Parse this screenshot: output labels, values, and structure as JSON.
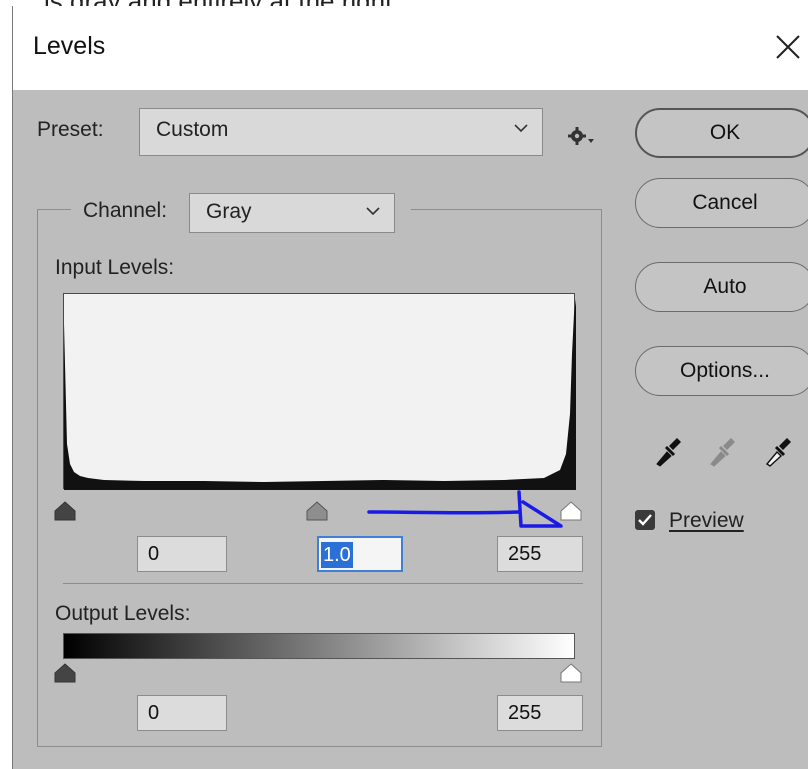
{
  "crop_text": "is gray and entirely at the right",
  "dialog": {
    "title": "Levels",
    "close_label": "close"
  },
  "preset": {
    "label": "Preset:",
    "value": "Custom"
  },
  "channel": {
    "label": "Channel:",
    "value": "Gray"
  },
  "input_levels": {
    "label": "Input Levels:",
    "black": "0",
    "gamma": "1.0",
    "white": "255"
  },
  "output_levels": {
    "label": "Output Levels:",
    "black": "0",
    "white": "255"
  },
  "buttons": {
    "ok": "OK",
    "cancel": "Cancel",
    "auto": "Auto",
    "options": "Options..."
  },
  "preview": {
    "label": "Preview",
    "checked": true
  },
  "icons": [
    "gear-icon",
    "black-eyedropper-icon",
    "gray-eyedropper-icon",
    "white-eyedropper-icon",
    "close-icon"
  ],
  "colors": {
    "dialog_bg": "#bdbdbd",
    "histogram_bg": "#f2f2f2",
    "annotation": "#1a1ae6",
    "active_field": "#2b70d6"
  }
}
